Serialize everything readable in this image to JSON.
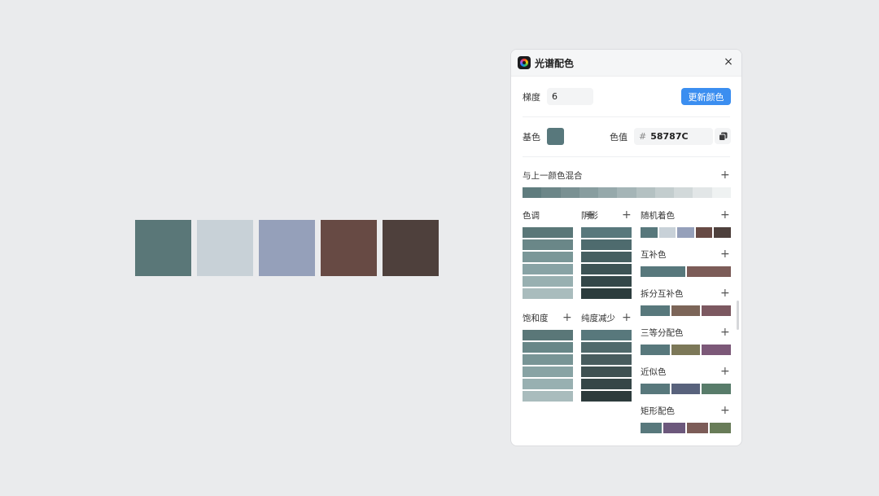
{
  "canvas": {
    "swatches": [
      "#5a7778",
      "#c8d1d7",
      "#95a0ba",
      "#674a44",
      "#4e403c"
    ]
  },
  "panel": {
    "title": "光谱配色",
    "close_glyph": "×",
    "gradient_label": "梯度",
    "gradient_value": "6",
    "update_button": "更新颜色",
    "base_label": "基色",
    "base_color": "#58787C",
    "value_label": "色值",
    "hash": "#",
    "value": "58787C",
    "plus": "+",
    "mix": {
      "label": "与上一颜色混合",
      "colors": [
        "#5f7c7e",
        "#6c8688",
        "#7a9193",
        "#889d9f",
        "#96a9ab",
        "#a5b5b7",
        "#b4c1c2",
        "#c3cdce",
        "#d2d9da",
        "#e2e6e7",
        "#eff2f2"
      ]
    },
    "hue": {
      "label": "色调",
      "colors": [
        "#5a7778",
        "#6a8788",
        "#7a9798",
        "#88a3a5",
        "#98b0b1",
        "#a9bcbd"
      ]
    },
    "shadow": {
      "label": "阴影",
      "colors": [
        "#58787c",
        "#4e6b6e",
        "#465f61",
        "#3d5355",
        "#344749",
        "#2c3c3d"
      ]
    },
    "saturation": {
      "label": "饱和度",
      "colors": [
        "#5a7778",
        "#688788",
        "#789596",
        "#88a3a4",
        "#98b0b1",
        "#a9bcbd"
      ]
    },
    "desaturate": {
      "label": "纯度减少",
      "colors": [
        "#58787c",
        "#50696b",
        "#485c5e",
        "#3f5152",
        "#354647",
        "#2d3b3c"
      ]
    },
    "random": {
      "label": "随机着色",
      "colors": [
        "#58787c",
        "#c8d1d8",
        "#95a0ba",
        "#674a44",
        "#4e403c"
      ]
    },
    "complementary": {
      "label": "互补色",
      "colors": [
        "#58787c",
        "#7c5c58"
      ]
    },
    "split": {
      "label": "拆分互补色",
      "colors": [
        "#58787c",
        "#7c6558",
        "#7c5860"
      ]
    },
    "triadic": {
      "label": "三等分配色",
      "colors": [
        "#58787c",
        "#7c7858",
        "#7c5878"
      ]
    },
    "analogous": {
      "label": "近似色",
      "colors": [
        "#58787c",
        "#58627c",
        "#587c6a"
      ]
    },
    "tetradic": {
      "label": "矩形配色",
      "colors": [
        "#58787c",
        "#6c587c",
        "#7c5c58",
        "#687c58"
      ]
    }
  }
}
